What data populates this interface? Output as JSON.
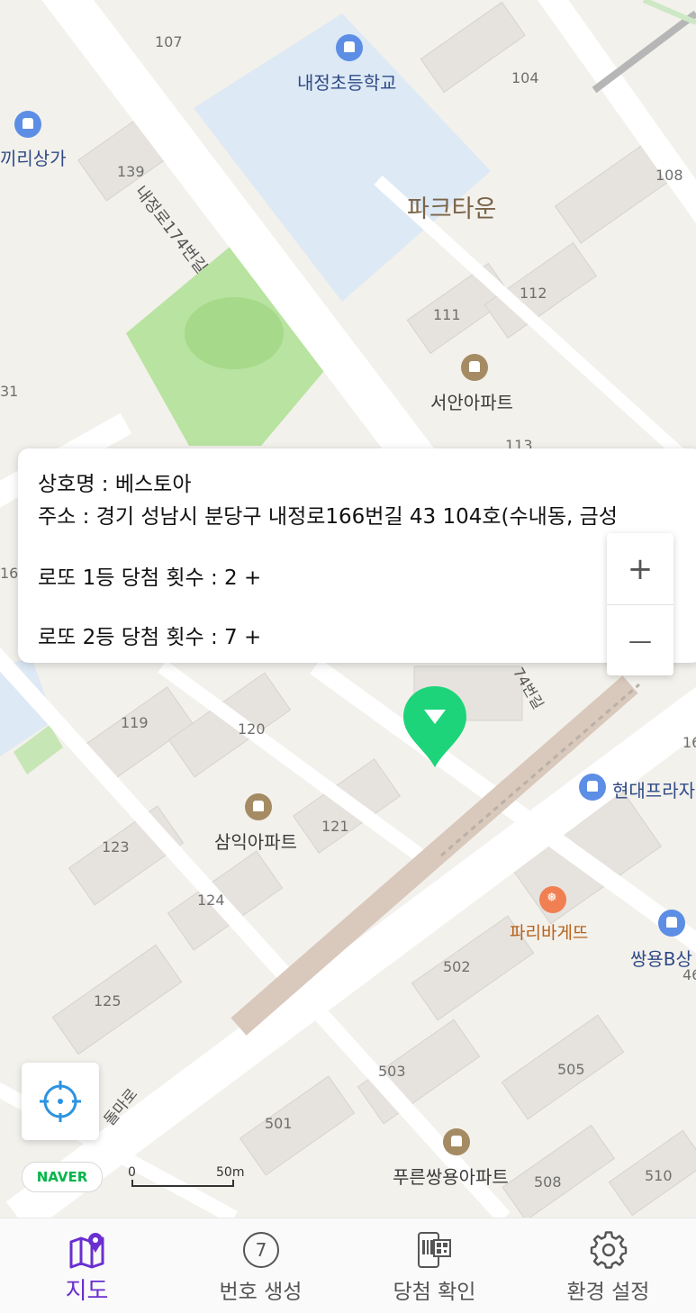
{
  "map": {
    "place_labels": [
      {
        "text": "내정초등학교",
        "kind": "school"
      },
      {
        "text": "끼리상가",
        "kind": "mall"
      },
      {
        "text": "파크타운",
        "kind": "area"
      },
      {
        "text": "서안아파트",
        "kind": "apartment"
      },
      {
        "text": "삼익아파트",
        "kind": "apartment"
      },
      {
        "text": "현대프라자",
        "kind": "mall"
      },
      {
        "text": "파리바게뜨",
        "kind": "restaurant"
      },
      {
        "text": "쌍용B상",
        "kind": "mall"
      },
      {
        "text": "푸른쌍용아파트",
        "kind": "apartment"
      }
    ],
    "street_labels": [
      "내정로174번길",
      "돌마로",
      "74번길"
    ],
    "building_numbers": [
      "107",
      "104",
      "139",
      "108",
      "112",
      "111",
      "113",
      "119",
      "120",
      "121",
      "123",
      "124",
      "125",
      "502",
      "503",
      "505",
      "501",
      "508",
      "510",
      "16",
      "31",
      "16",
      "46"
    ],
    "scale": {
      "zero": "0",
      "distance": "50m"
    },
    "brand": "NAVER"
  },
  "info_card": {
    "store_name_line": "상호명 : 베스토아",
    "address_line": "주소 : 경기 성남시 분당구 내정로166번길 43 104호(수내동, 금성",
    "first_prize_line": "로또 1등 당첨 횟수 :  2 +",
    "second_prize_line": "로또 2등 당첨 횟수 :  7 +"
  },
  "zoom": {
    "plus": "+",
    "minus": "—"
  },
  "tabs": [
    {
      "label": "지도",
      "icon": "map-pin-icon",
      "active": true
    },
    {
      "label": "번호 생성",
      "icon": "lotto-ball-icon",
      "ball": "7",
      "active": false
    },
    {
      "label": "당첨 확인",
      "icon": "qr-scan-icon",
      "active": false
    },
    {
      "label": "환경 설정",
      "icon": "gear-icon",
      "active": false
    }
  ],
  "colors": {
    "accent": "#6a2fd0",
    "marker": "#1ed47a",
    "naver": "#03b54a"
  }
}
